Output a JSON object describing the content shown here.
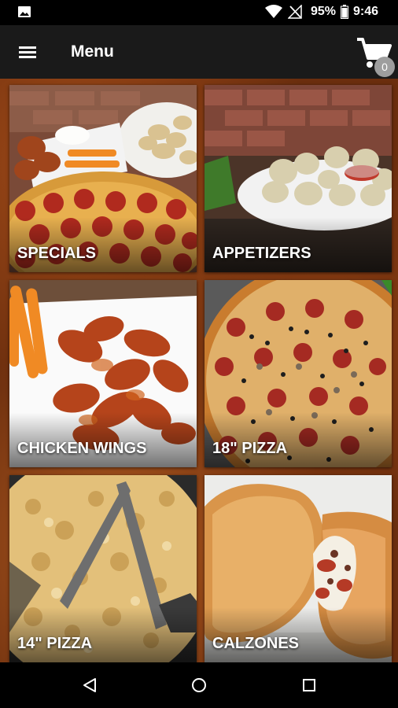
{
  "status_bar": {
    "battery": "95%",
    "time": "9:46"
  },
  "app_bar": {
    "title": "Menu",
    "cart_count": "0"
  },
  "categories": [
    {
      "label": "SPECIALS"
    },
    {
      "label": "APPETIZERS"
    },
    {
      "label": "CHICKEN WINGS"
    },
    {
      "label": "18\" PIZZA"
    },
    {
      "label": "14\" PIZZA"
    },
    {
      "label": "CALZONES"
    }
  ],
  "icons": {
    "menu": "hamburger-menu-icon",
    "cart": "shopping-cart-icon",
    "back": "triangle-back-icon",
    "home": "circle-home-icon",
    "recents": "square-recents-icon"
  },
  "colors": {
    "app_bar": "#1a1a1a",
    "badge": "#9e9e9e",
    "background": "#6b2e0e"
  }
}
